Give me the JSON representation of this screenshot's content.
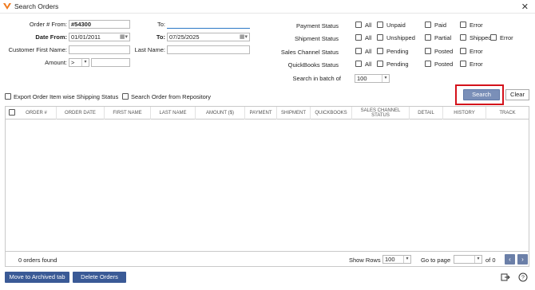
{
  "window": {
    "title": "Search Orders",
    "close_glyph": "✕"
  },
  "form": {
    "order_from_label": "Order # From:",
    "order_from_value": "#54300",
    "to_label_1": "To:",
    "to_value_1": "",
    "date_from_label": "Date From:",
    "date_from_value": "01/01/2011",
    "to_label_2": "To:",
    "to_value_2": "07/25/2025",
    "first_name_label": "Customer First Name:",
    "last_name_label": "Last Name:",
    "amount_label": "Amount:",
    "amount_operator": ">",
    "amount_value": ""
  },
  "status_filters": {
    "payment_label": "Payment Status",
    "payment_options": [
      "All",
      "Unpaid",
      "Paid",
      "Error"
    ],
    "shipment_label": "Shipment Status",
    "shipment_options": [
      "All",
      "Unshipped",
      "Partial",
      "Shipped",
      "Error"
    ],
    "sales_channel_label": "Sales Channel Status",
    "sales_channel_options": [
      "All",
      "Pending",
      "Posted",
      "Error"
    ],
    "quickbooks_label": "QuickBooks Status",
    "quickbooks_options": [
      "All",
      "Pending",
      "Posted",
      "Error"
    ],
    "batch_label": "Search in batch of",
    "batch_value": "100"
  },
  "options": {
    "export_label": "Export Order Item wise Shipping Status",
    "repository_label": "Search Order from Repository"
  },
  "buttons": {
    "search": "Search",
    "clear": "Clear",
    "archive": "Move to Archived tab",
    "delete": "Delete Orders"
  },
  "grid": {
    "columns": [
      "ORDER #",
      "ORDER DATE",
      "FIRST NAME",
      "LAST NAME",
      "AMOUNT ($)",
      "PAYMENT",
      "SHIPMENT",
      "QUICKBOOKS",
      "SALES CHANNEL STATUS",
      "DETAIL",
      "HISTORY",
      "TRACK"
    ],
    "rows": []
  },
  "footer": {
    "count_text": "0 orders found",
    "show_rows_label": "Show Rows",
    "show_rows_value": "100",
    "goto_label": "Go to page",
    "page_value": "",
    "of_text": "of 0",
    "prev_glyph": "‹",
    "next_glyph": "›"
  },
  "icons": {
    "logo": "app-logo-icon",
    "exit": "exit-icon",
    "help": "help-icon"
  },
  "colors": {
    "accent": "#3a5a96",
    "search_button": "#7a8fb8",
    "highlight": "#d4121b",
    "logo": "#f07a1e"
  }
}
